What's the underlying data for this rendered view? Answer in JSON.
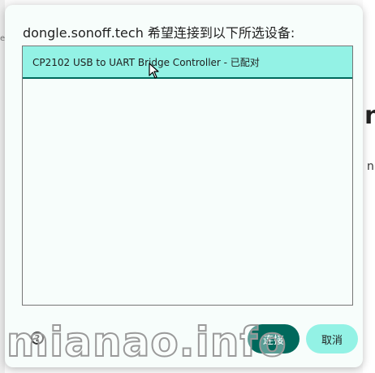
{
  "background": {
    "fragment_left": "ea",
    "fragment_right_large": "n",
    "fragment_right_small": "n"
  },
  "dialog": {
    "title": "dongle.sonoff.tech 希望连接到以下所选设备:",
    "devices": [
      {
        "label": "CP2102 USB to UART Bridge Controller - 已配对",
        "selected": true
      }
    ],
    "help_icon": "question-mark-icon",
    "help_glyph": "?",
    "connect_label": "连接",
    "cancel_label": "取消"
  },
  "watermark": "mianao.info",
  "colors": {
    "accent": "#00695c",
    "selected_bg": "#93f2e5",
    "dialog_bg": "#f7fdfb"
  }
}
